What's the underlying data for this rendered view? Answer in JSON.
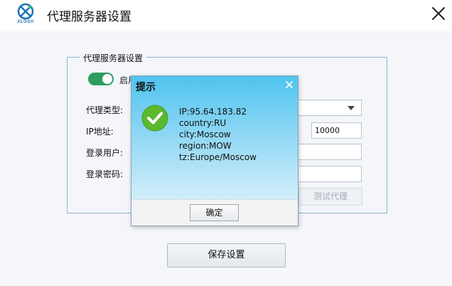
{
  "window": {
    "title": "代理服务器设置",
    "logo_text": "XLOGII"
  },
  "group": {
    "legend": "代理服务器设置",
    "toggle_label": "启用",
    "toggle_on": true,
    "labels": {
      "type": "代理类型:",
      "ip": "IP地址:",
      "user": "登录用户:",
      "password": "登录密码:"
    },
    "port_value": "10000",
    "test_button": "测试代理"
  },
  "save_button": "保存设置",
  "dialog": {
    "title": "提示",
    "lines": [
      "IP:95.64.183.82",
      "country:RU",
      "city:Moscow",
      "region:MOW",
      "tz:Europe/Moscow"
    ],
    "ok_button": "确定"
  },
  "icons": {
    "logo": "xlogii-logo-icon",
    "close": "close-icon",
    "dropdown": "chevron-down-icon",
    "success": "check-circle-icon"
  },
  "colors": {
    "toggle_on": "#2e9d5f",
    "success_green": "#5cb82d",
    "dialog_header": "#4fc3ee",
    "group_border": "#8db3cf"
  }
}
